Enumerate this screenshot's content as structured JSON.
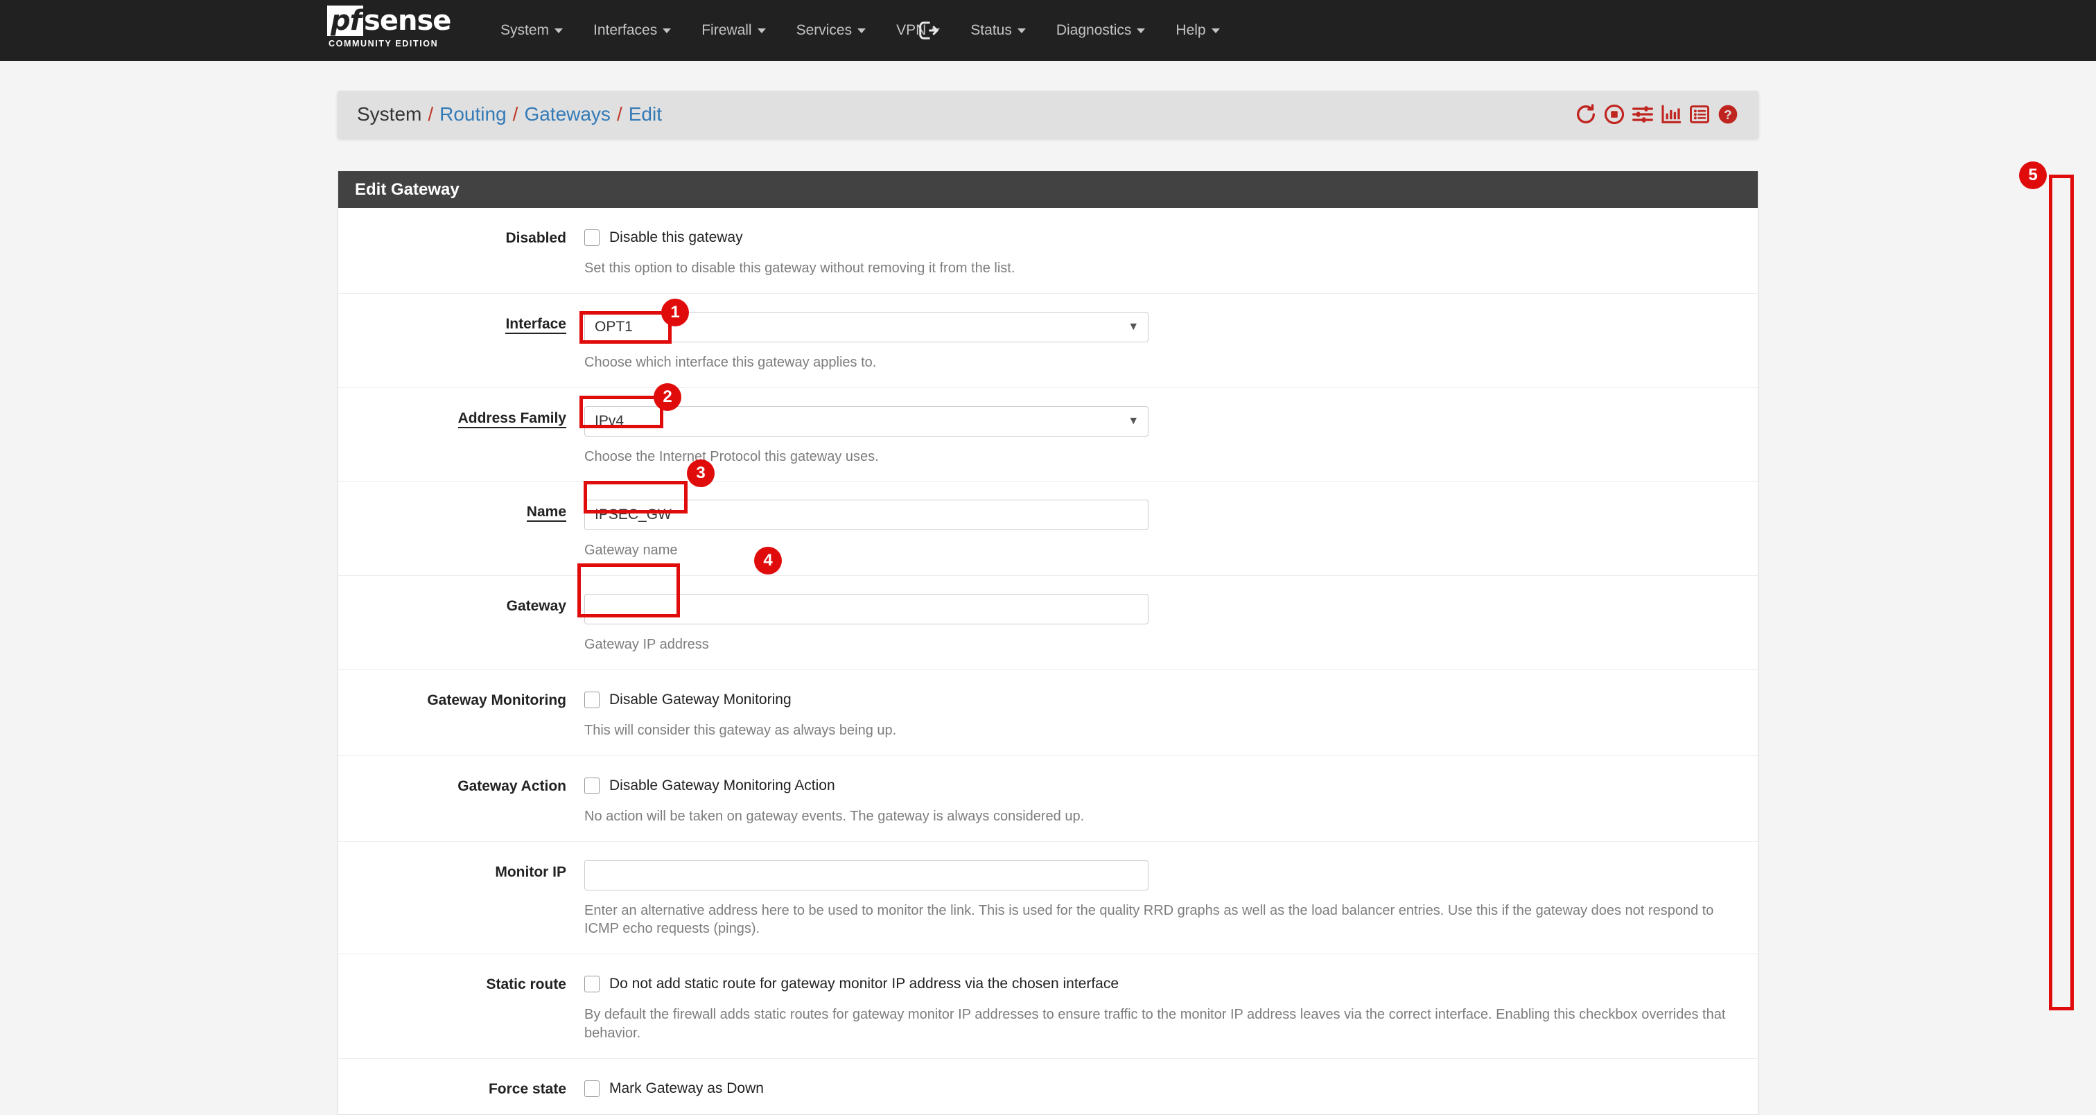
{
  "navbar": {
    "brand_pf": "pf",
    "brand_sense": "sense",
    "brand_subtitle": "COMMUNITY EDITION",
    "items": [
      {
        "label": "System",
        "icon": "chevron-down-icon"
      },
      {
        "label": "Interfaces",
        "icon": "chevron-down-icon"
      },
      {
        "label": "Firewall",
        "icon": "chevron-down-icon"
      },
      {
        "label": "Services",
        "icon": "chevron-down-icon"
      },
      {
        "label": "VPN",
        "icon": "chevron-down-icon"
      },
      {
        "label": "Status",
        "icon": "chevron-down-icon"
      },
      {
        "label": "Diagnostics",
        "icon": "chevron-down-icon"
      },
      {
        "label": "Help",
        "icon": "chevron-down-icon"
      }
    ],
    "logout_icon": "logout-icon"
  },
  "breadcrumb": {
    "items": [
      {
        "label": "System",
        "is_link": false
      },
      {
        "label": "Routing",
        "is_link": true
      },
      {
        "label": "Gateways",
        "is_link": true
      },
      {
        "label": "Edit",
        "is_link": true
      }
    ],
    "separator": "/",
    "icons": [
      "restart-icon",
      "stop-icon",
      "sliders-icon",
      "chart-icon",
      "list-icon",
      "help-icon"
    ]
  },
  "panel": {
    "title": "Edit Gateway",
    "rows": [
      {
        "label": "Disabled",
        "required": false,
        "type": "checkbox",
        "checkbox_label": "Disable this gateway",
        "checked": false,
        "help": "Set this option to disable this gateway without removing it from the list."
      },
      {
        "label": "Interface",
        "required": true,
        "type": "select",
        "value": "OPT1",
        "help": "Choose which interface this gateway applies to."
      },
      {
        "label": "Address Family",
        "required": true,
        "type": "select",
        "value": "IPv4",
        "help": "Choose the Internet Protocol this gateway uses."
      },
      {
        "label": "Name",
        "required": true,
        "type": "text",
        "value": "IPSEC_GW",
        "placeholder": "",
        "help": "Gateway name"
      },
      {
        "label": "Gateway",
        "required": false,
        "type": "text",
        "value": "",
        "placeholder": "",
        "help": "Gateway IP address"
      },
      {
        "label": "Gateway Monitoring",
        "required": false,
        "type": "checkbox",
        "checkbox_label": "Disable Gateway Monitoring",
        "checked": false,
        "help": "This will consider this gateway as always being up."
      },
      {
        "label": "Gateway Action",
        "required": false,
        "type": "checkbox",
        "checkbox_label": "Disable Gateway Monitoring Action",
        "checked": false,
        "help": "No action will be taken on gateway events. The gateway is always considered up."
      },
      {
        "label": "Monitor IP",
        "required": false,
        "type": "text",
        "value": "",
        "placeholder": "",
        "help": "Enter an alternative address here to be used to monitor the link. This is used for the quality RRD graphs as well as the load balancer entries. Use this if the gateway does not respond to ICMP echo requests (pings)."
      },
      {
        "label": "Static route",
        "required": false,
        "type": "checkbox",
        "checkbox_label": "Do not add static route for gateway monitor IP address via the chosen interface",
        "checked": false,
        "help": "By default the firewall adds static routes for gateway monitor IP addresses to ensure traffic to the monitor IP address leaves via the correct interface. Enabling this checkbox overrides that behavior."
      },
      {
        "label": "Force state",
        "required": false,
        "type": "checkbox",
        "checkbox_label": "Mark Gateway as Down",
        "checked": false,
        "help": ""
      }
    ]
  },
  "annotations": {
    "color": "#e00c0c",
    "badges": [
      {
        "number": "1",
        "target": "interface-select"
      },
      {
        "number": "2",
        "target": "address-family-select"
      },
      {
        "number": "3",
        "target": "name-input"
      },
      {
        "number": "4",
        "target": "gateway-input"
      },
      {
        "number": "5",
        "target": "page-scrollbar"
      }
    ]
  }
}
